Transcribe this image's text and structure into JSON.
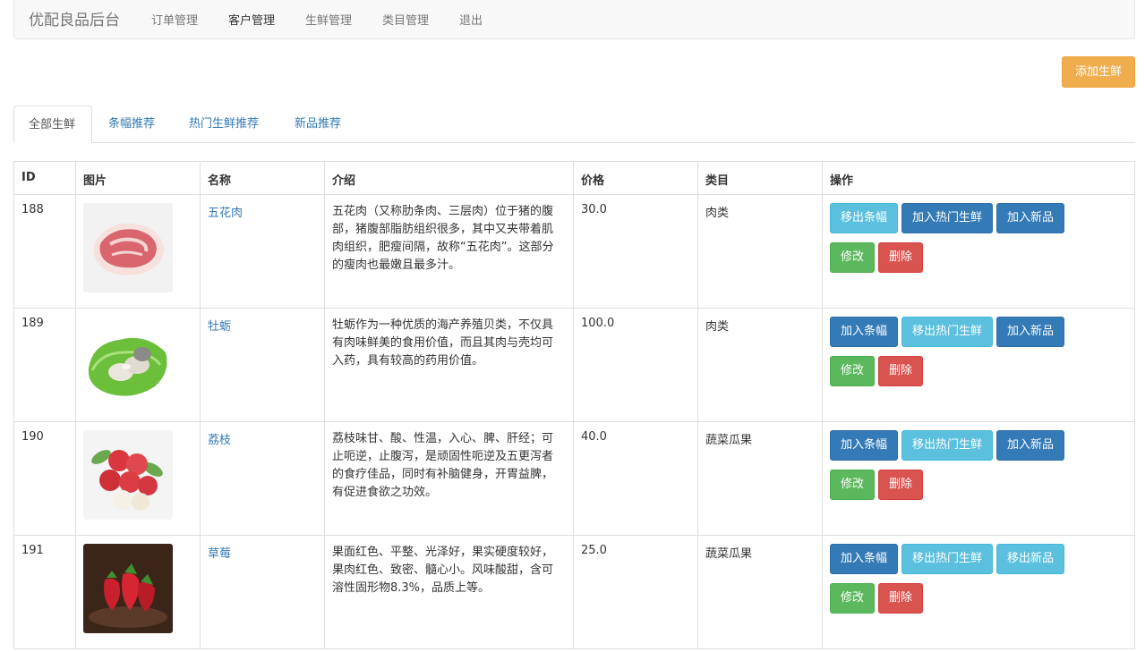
{
  "navbar": {
    "brand": "优配良品后台",
    "links": [
      "订单管理",
      "客户管理",
      "生鲜管理",
      "类目管理",
      "退出"
    ]
  },
  "toolbar": {
    "add_label": "添加生鲜"
  },
  "tabs": [
    "全部生鲜",
    "条幅推荐",
    "热门生鲜推荐",
    "新品推荐"
  ],
  "table": {
    "headers": [
      "ID",
      "图片",
      "名称",
      "介绍",
      "价格",
      "类目",
      "操作"
    ],
    "rows": [
      {
        "id": "188",
        "name": "五花肉",
        "desc": "五花肉（又称肋条肉、三层肉）位于猪的腹部，猪腹部脂肪组织很多，其中又夹带着肌肉组织，肥瘦间隔，故称“五花肉”。这部分的瘦肉也最嫩且最多汁。",
        "price": "30.0",
        "category": "肉类",
        "banner_btn": "移出条幅",
        "hot_btn": "加入热门生鲜",
        "new_btn": "加入新品",
        "edit_btn": "修改",
        "delete_btn": "删除"
      },
      {
        "id": "189",
        "name": "牡蛎",
        "desc": "牡蛎作为一种优质的海产养殖贝类，不仅具有肉味鲜美的食用价值，而且其肉与壳均可入药，具有较高的药用价值。",
        "price": "100.0",
        "category": "肉类",
        "banner_btn": "加入条幅",
        "hot_btn": "移出热门生鲜",
        "new_btn": "加入新品",
        "edit_btn": "修改",
        "delete_btn": "删除"
      },
      {
        "id": "190",
        "name": "荔枝",
        "desc": "荔枝味甘、酸、性温，入心、脾、肝经；可止呃逆，止腹泻，是顽固性呃逆及五更泻者的食疗佳品，同时有补脑健身，开胃益脾，有促进食欲之功效。",
        "price": "40.0",
        "category": "蔬菜瓜果",
        "banner_btn": "加入条幅",
        "hot_btn": "移出热门生鲜",
        "new_btn": "加入新品",
        "edit_btn": "修改",
        "delete_btn": "删除"
      },
      {
        "id": "191",
        "name": "草莓",
        "desc": "果面红色、平整、光泽好，果实硬度较好，果肉红色、致密、髓心小。风味酸甜，含可溶性固形物8.3%，品质上等。",
        "price": "25.0",
        "category": "蔬菜瓜果",
        "banner_btn": "加入条幅",
        "hot_btn": "移出热门生鲜",
        "new_btn": "移出新品",
        "edit_btn": "修改",
        "delete_btn": "删除"
      }
    ]
  },
  "colors": {
    "primary": "#337ab7",
    "info": "#5bc0de",
    "success": "#5cb85c",
    "danger": "#d9534f",
    "warning": "#f0ad4e"
  }
}
